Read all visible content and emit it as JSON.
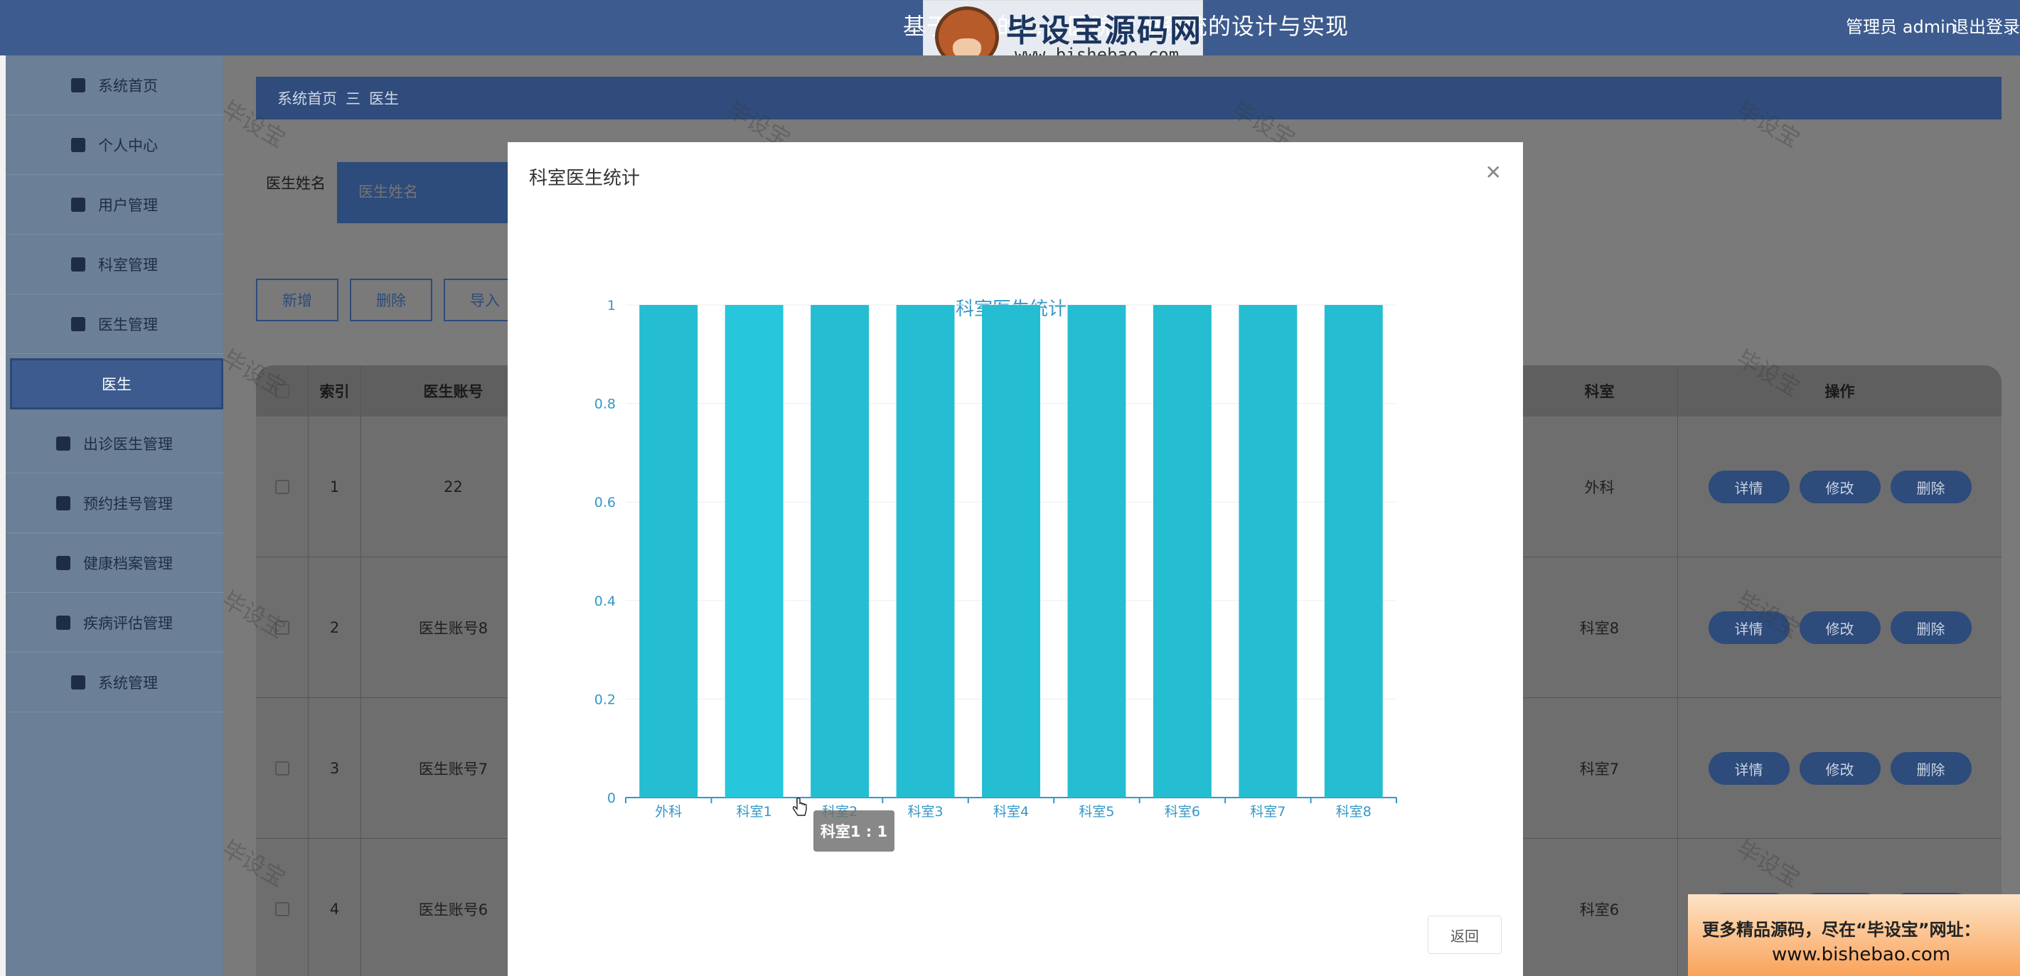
{
  "header": {
    "title": "基于……的……医院管理系统的设计与实现",
    "admin_label": "管理员 admin",
    "logout_label": "退出登录"
  },
  "logo": {
    "name": "毕设宝源码网",
    "url": "www.bishebao.com"
  },
  "sidebar": {
    "items": [
      {
        "label": "系统首页",
        "icon": "home-icon"
      },
      {
        "label": "个人中心",
        "icon": "user-icon"
      },
      {
        "label": "用户管理",
        "icon": "briefcase-icon"
      },
      {
        "label": "科室管理",
        "icon": "clipboard-icon"
      },
      {
        "label": "医生管理",
        "icon": "grid-icon"
      },
      {
        "label": "医生",
        "icon": "",
        "active": true
      },
      {
        "label": "出诊医生管理",
        "icon": "pin-icon"
      },
      {
        "label": "预约挂号管理",
        "icon": "grid-icon"
      },
      {
        "label": "健康档案管理",
        "icon": "grid-icon"
      },
      {
        "label": "疾病评估管理",
        "icon": "briefcase-icon"
      },
      {
        "label": "系统管理",
        "icon": "clipboard-icon"
      }
    ]
  },
  "breadcrumb": {
    "home": "系统首页",
    "separator": "三",
    "current": "医生"
  },
  "search": {
    "label": "医生姓名",
    "placeholder": "医生姓名"
  },
  "toolbar": {
    "add_label": "新增",
    "delete_label": "删除",
    "import_label": "导入"
  },
  "table": {
    "columns": {
      "index": "索引",
      "account": "医生账号",
      "department": "科室",
      "actions": "操作"
    },
    "rows": [
      {
        "index": "1",
        "account": "22",
        "department": "外科"
      },
      {
        "index": "2",
        "account": "医生账号8",
        "department": "科室8"
      },
      {
        "index": "3",
        "account": "医生账号7",
        "department": "科室7"
      },
      {
        "index": "4",
        "account": "医生账号6",
        "department": "科室6"
      }
    ],
    "action_labels": {
      "detail": "详情",
      "edit": "修改",
      "delete": "删除"
    }
  },
  "watermark_text": "毕设宝",
  "modal": {
    "title": "科室医生统计",
    "close_icon": "close-icon",
    "back_label": "返回",
    "tooltip": "科室1 : 1"
  },
  "chart_data": {
    "type": "bar",
    "title": "科室医生统计",
    "categories": [
      "外科",
      "科室1",
      "科室2",
      "科室3",
      "科室4",
      "科室5",
      "科室6",
      "科室7",
      "科室8"
    ],
    "values": [
      1,
      1,
      1,
      1,
      1,
      1,
      1,
      1,
      1
    ],
    "ylim": [
      0,
      1
    ],
    "yticks": [
      "0",
      "0.2",
      "0.4",
      "0.6",
      "0.8",
      "1"
    ],
    "grid": true,
    "colors": {
      "bar": "#24bdd1",
      "bar_highlight": "#26c7dc",
      "axis": "#3398c8"
    }
  },
  "ad": {
    "line1": "更多精品源码，尽在“毕设宝”网址：",
    "line2": "www.bishebao.com"
  }
}
